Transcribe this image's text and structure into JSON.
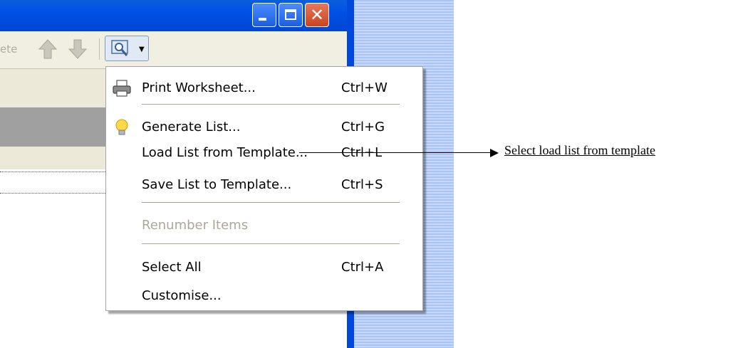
{
  "toolbar": {
    "delete_label": "ete",
    "icons": [
      "up-arrow-icon",
      "down-arrow-icon",
      "find-dropdown-icon"
    ]
  },
  "menu": {
    "items": [
      {
        "label": "Print Worksheet...",
        "shortcut": "Ctrl+W",
        "icon": "printer-icon"
      },
      {
        "label": "Generate List...",
        "shortcut": "Ctrl+G",
        "icon": "lightbulb-icon"
      },
      {
        "label": "Load List from Template...",
        "shortcut": "Ctrl+L"
      },
      {
        "label": "Save List to Template...",
        "shortcut": "Ctrl+S"
      },
      {
        "label": "Renumber Items",
        "shortcut": "",
        "disabled": true
      },
      {
        "label": "Select All",
        "shortcut": "Ctrl+A"
      },
      {
        "label": "Customise...",
        "shortcut": ""
      }
    ]
  },
  "callout": {
    "text": "Select load list from template"
  },
  "colors": {
    "titlebar": "#0050e6",
    "close_button": "#c8451f",
    "menu_disabled": "#aca899"
  }
}
